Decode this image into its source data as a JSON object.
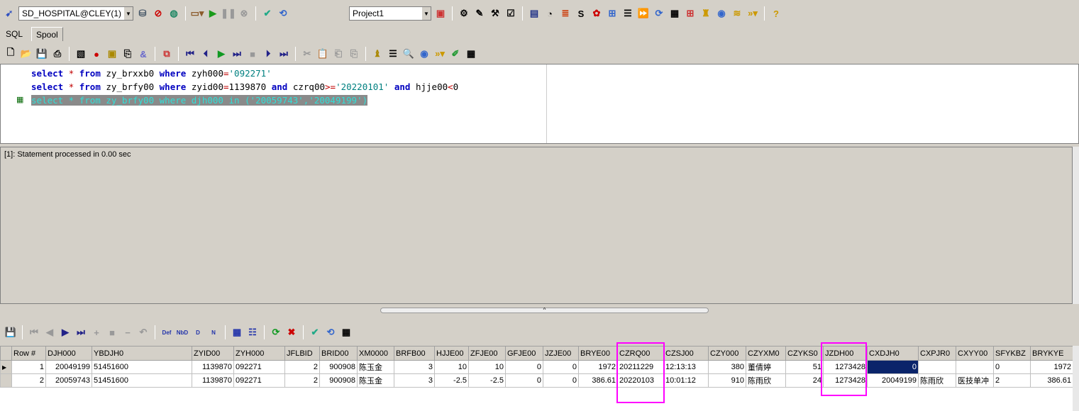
{
  "toolbar_main": {
    "connection": "SD_HOSPITAL@CLEY(1)",
    "project": "Project1",
    "icons": [
      "connect-icon",
      "logon-icon",
      "break-icon",
      "web-icon",
      "window-list-icon",
      "execute-icon",
      "pause-icon",
      "stop-icon",
      "commit-icon",
      "rollback-icon"
    ]
  },
  "tabs": [
    {
      "label": "SQL"
    },
    {
      "label": "Spool"
    }
  ],
  "sql_toolbar": {
    "icons": [
      "new-icon",
      "open-sql-icon",
      "save-icon",
      "print-icon",
      "query-builder-icon",
      "explain-plan-icon",
      "import-icon",
      "select-icon",
      "substitution-icon",
      "copy-icon",
      "first-icon",
      "prior-icon",
      "next-icon",
      "last-icon",
      "stop-icon",
      "next-page-icon",
      "last-page-icon",
      "cut-icon",
      "paste-icon",
      "search-icon",
      "bind-icon"
    ]
  },
  "editor": {
    "lines": [
      {
        "kw1": "select",
        "star": "*",
        "kw2": "from",
        "t1": "zy_brxxb0",
        "kw3": "where",
        "c": "zyh000",
        "eq": "=",
        "s": "'092271'"
      },
      {
        "kw1": "select",
        "star": "*",
        "kw2": "from",
        "t1": "zy_brfy00",
        "kw3": "where",
        "c": "zyid00",
        "eq": "=",
        "v": "1139870",
        "and1": "and",
        "c2": "czrq00",
        ">=": ">=",
        "s": "'20220101'",
        "and2": "and",
        "c3": "hjje00",
        "lt": "<",
        "v2": "0"
      },
      {
        "text": "select * from zy_brfy00 where djh000 in ('20059743','20049199')"
      }
    ]
  },
  "output": {
    "message": "[1]: Statement processed in 0.00 sec"
  },
  "grid": {
    "columns": [
      "Row #",
      "DJH000",
      "YBDJH0",
      "ZYID00",
      "ZYH000",
      "JFLBID",
      "BRID00",
      "XM0000",
      "BRFB00",
      "HJJE00",
      "ZFJE00",
      "GFJE00",
      "JZJE00",
      "BRYE00",
      "CZRQ00",
      "CZSJ00",
      "CZY000",
      "CZYXM0",
      "CZYKS0",
      "JZDH00",
      "CXDJH0",
      "CXPJR0",
      "CXYY00",
      "SFYKBZ",
      "BRYKYE"
    ],
    "rows": [
      [
        "1",
        "20049199",
        "51451600",
        "1139870",
        "092271",
        "2",
        "900908",
        "陈玉金",
        "3",
        "10",
        "10",
        "0",
        "0",
        "1972",
        "20211229",
        "12:13:13",
        "380",
        "董倩婷",
        "51",
        "1273428",
        "0",
        "",
        "",
        "0",
        "1972"
      ],
      [
        "2",
        "20059743",
        "51451600",
        "1139870",
        "092271",
        "2",
        "900908",
        "陈玉金",
        "3",
        "-2.5",
        "-2.5",
        "0",
        "0",
        "386.61",
        "20220103",
        "10:01:12",
        "910",
        "陈雨欣",
        "24",
        "1273428",
        "20049199",
        "陈雨欣",
        "医技单冲",
        "2",
        "386.61"
      ]
    ],
    "highlight_color": "#ff00ff"
  }
}
